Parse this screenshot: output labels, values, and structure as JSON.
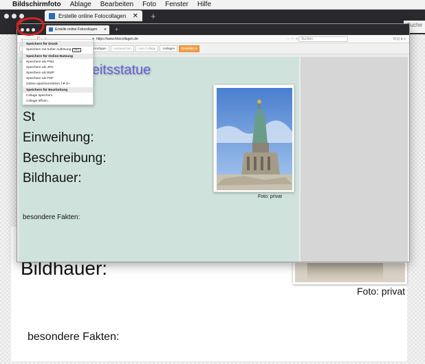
{
  "menubar": {
    "apple_symbol": "",
    "items": [
      "Bildschirmfoto",
      "Ablage",
      "Bearbeiten",
      "Foto",
      "Fenster",
      "Hilfe"
    ]
  },
  "outer_browser": {
    "tab_title": "Erstelle online Fotocollagen",
    "tab_close": "✕",
    "new_tab": "+",
    "search_peek": "Suche"
  },
  "inner_browser": {
    "tab_title": "Erstelle online Fotocollagen",
    "tab_close": "×",
    "new_tab": "+",
    "nav": {
      "back": "←",
      "forward": "→",
      "reload": "C",
      "home": "⌂"
    },
    "url": "https://www.fotocollagen.de",
    "url_icons": "··· ♡ ☆",
    "search_placeholder": "Suchen",
    "right_icons": "IIl ⊡ ● ≡"
  },
  "toolbar": {
    "collage": "Collage",
    "datei": "Datei ▾",
    "bilder_hinzufuegen": "ilder hinzufügen",
    "text_hinzufuegen": "Text hinzufügen",
    "austauschen": "Austauschen",
    "auto_collage": "Auto Collage",
    "vorlagen": "Vorlagen",
    "bestellen": "Bestellen ▾"
  },
  "dropdown": {
    "sections": [
      {
        "header": "Speichern für Druck",
        "items": [
          {
            "label": "Speichern mit hoher Auflösung",
            "badge": "PRO"
          }
        ]
      },
      {
        "header": "Speichern für Online-Nutzung",
        "items": [
          {
            "label": "Speichere als PNG"
          },
          {
            "label": "Speichere als JPG"
          },
          {
            "label": "Speichere als BMP"
          },
          {
            "label": "Speichere als PDF"
          },
          {
            "label": "Online speichern/teilen",
            "social": "f ♥ G+"
          }
        ]
      },
      {
        "header": "Speichern für Bearbeitung",
        "items": [
          {
            "label": "Collage speichern"
          },
          {
            "label": "Collage öffnen..."
          }
        ]
      }
    ]
  },
  "canvas": {
    "zoom": "1:14",
    "title": "eiheitsstatue",
    "labels": [
      "Gr",
      "St",
      "Einweihung:",
      "Beschreibung:",
      "Bildhauer:"
    ],
    "photo_caption": "Foto: privat",
    "fakten": "besondere Fakten:",
    "bg_color": "#cfe3dc",
    "title_color": "#6a5fd8"
  },
  "background_page": {
    "bildhauer": "Bildhauer:",
    "photo_caption": "Foto: privat",
    "fakten": "besondere Fakten:"
  }
}
